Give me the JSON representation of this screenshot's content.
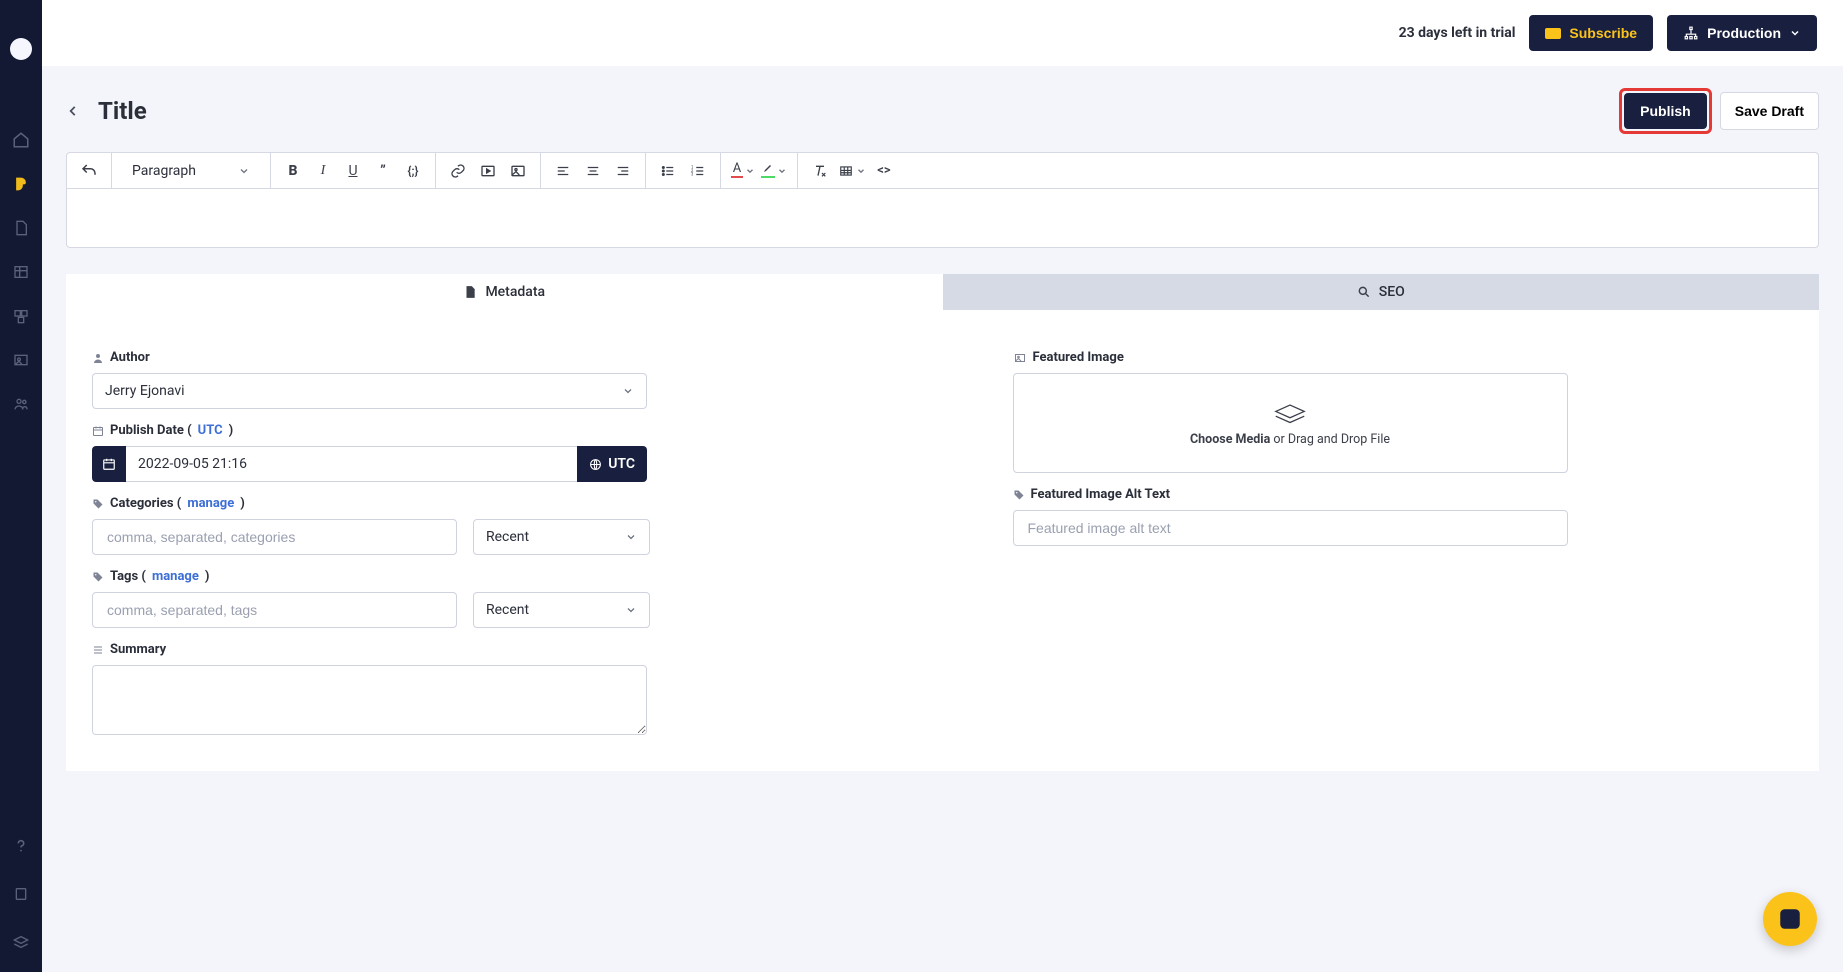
{
  "topbar": {
    "trial_text": "23 days left in trial",
    "subscribe_label": "Subscribe",
    "production_label": "Production"
  },
  "titlerow": {
    "title": "Title",
    "publish_label": "Publish",
    "save_draft_label": "Save Draft"
  },
  "toolbar": {
    "paragraph_label": "Paragraph"
  },
  "tabs": {
    "metadata_label": "Metadata",
    "seo_label": "SEO"
  },
  "form": {
    "author_label": "Author",
    "author_value": "Jerry Ejonavi",
    "publish_date_label_prefix": "Publish Date ( ",
    "publish_date_tz_link": "UTC",
    "publish_date_label_suffix": " )",
    "publish_date_value": "2022-09-05 21:16",
    "utc_button": "UTC",
    "categories_label_prefix": "Categories (",
    "categories_manage": "manage",
    "categories_label_suffix": ")",
    "categories_placeholder": "comma, separated, categories",
    "categories_recent": "Recent",
    "tags_label_prefix": "Tags (",
    "tags_manage": "manage",
    "tags_label_suffix": ")",
    "tags_placeholder": "comma, separated, tags",
    "tags_recent": "Recent",
    "summary_label": "Summary",
    "featured_image_label": "Featured Image",
    "choose_media_strong": "Choose Media",
    "choose_media_rest": " or Drag and Drop File",
    "alt_text_label": "Featured Image Alt Text",
    "alt_text_placeholder": "Featured image alt text"
  }
}
